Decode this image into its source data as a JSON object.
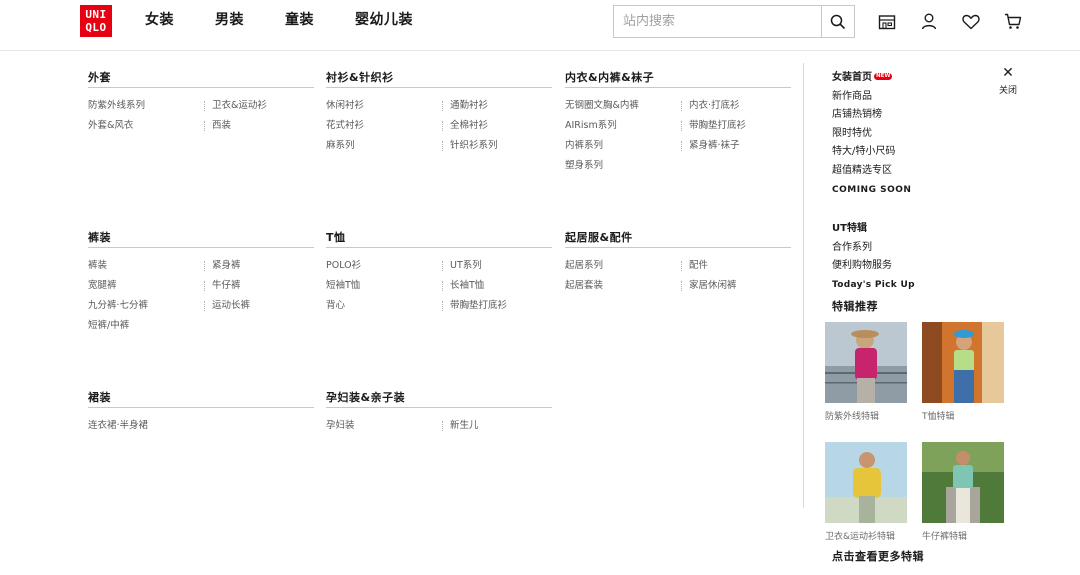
{
  "logo": {
    "line1": "UNI",
    "line2": "QLO",
    "color": "#e60012"
  },
  "topnav": [
    "女装",
    "男装",
    "童装",
    "婴幼儿装"
  ],
  "search": {
    "placeholder": "站内搜索",
    "icon": "search-icon"
  },
  "header_icons": [
    "store-icon",
    "user-icon",
    "heart-icon",
    "cart-icon"
  ],
  "menu": {
    "outerwear": {
      "title": "外套",
      "links": [
        "防紫外线系列",
        "卫衣&运动衫",
        "外套&风衣",
        "西装"
      ]
    },
    "shirts": {
      "title": "衬衫&针织衫",
      "links": [
        "休闲衬衫",
        "通勤衬衫",
        "花式衬衫",
        "全棉衬衫",
        "麻系列",
        "针织衫系列"
      ]
    },
    "innerwear": {
      "title": "内衣&内裤&袜子",
      "links": [
        "无钢圈文胸&内裤",
        "内衣·打底衫",
        "AIRism系列",
        "带胸垫打底衫",
        "内裤系列",
        "紧身裤·袜子",
        "塑身系列"
      ]
    },
    "pants": {
      "title": "裤装",
      "links": [
        "裤装",
        "紧身裤",
        "宽腿裤",
        "牛仔裤",
        "九分裤·七分裤",
        "运动长裤",
        "短裤/中裤"
      ]
    },
    "tshirts": {
      "title": "T恤",
      "links": [
        "POLO衫",
        "UT系列",
        "短袖T恤",
        "长袖T恤",
        "背心",
        "带胸垫打底衫"
      ]
    },
    "loungewear": {
      "title": "起居服&配件",
      "links": [
        "起居系列",
        "配件",
        "起居套装",
        "家居休闲裤"
      ]
    },
    "skirts": {
      "title": "裙装",
      "links": [
        "连衣裙·半身裙"
      ]
    },
    "maternity": {
      "title": "孕妇装&亲子装",
      "links": [
        "孕妇装",
        "新生儿"
      ]
    }
  },
  "side": {
    "close_label": "关闭",
    "home": "女装首页",
    "new_badge": "NEW",
    "group1": [
      "新作商品",
      "店铺热销榜",
      "限时特优",
      "特大/特小尺码",
      "超值精选专区",
      "COMING SOON"
    ],
    "ut_title": "UT特辑",
    "group2": [
      "合作系列",
      "便利购物服务",
      "Today's Pick Up"
    ],
    "featured_title": "特辑推荐",
    "featured": [
      "防紫外线特辑",
      "T恤特辑",
      "卫衣&运动衫特辑",
      "牛仔裤特辑"
    ],
    "see_more": "点击查看更多特辑"
  }
}
